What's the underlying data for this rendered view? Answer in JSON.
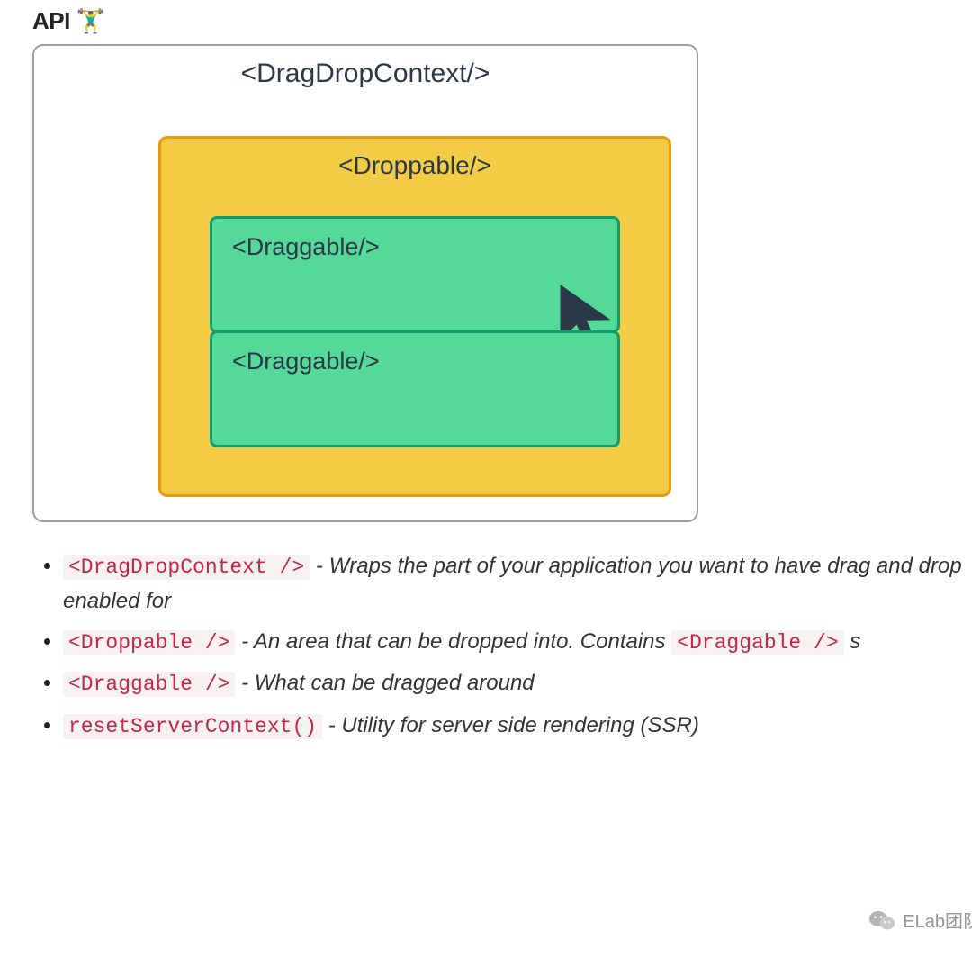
{
  "heading": "API 🏋️‍♂️",
  "diagram": {
    "context_label": "<DragDropContext/>",
    "droppable_label": "<Droppable/>",
    "draggable_label_1": "<Draggable/>",
    "draggable_label_2": "<Draggable/>"
  },
  "api_items": [
    {
      "code": "<DragDropContext />",
      "desc_pre": " - Wraps the part of your application you want to have drag and drop enabled for"
    },
    {
      "code": "<Droppable />",
      "desc_pre": " - An area that can be dropped into. Contains ",
      "code2": "<Draggable />",
      "desc_post": " s"
    },
    {
      "code": "<Draggable />",
      "desc_pre": " - What can be dragged around"
    },
    {
      "code": "resetServerContext()",
      "desc_pre": " - Utility for server side rendering (SSR)"
    }
  ],
  "watermark": "ELab团队"
}
